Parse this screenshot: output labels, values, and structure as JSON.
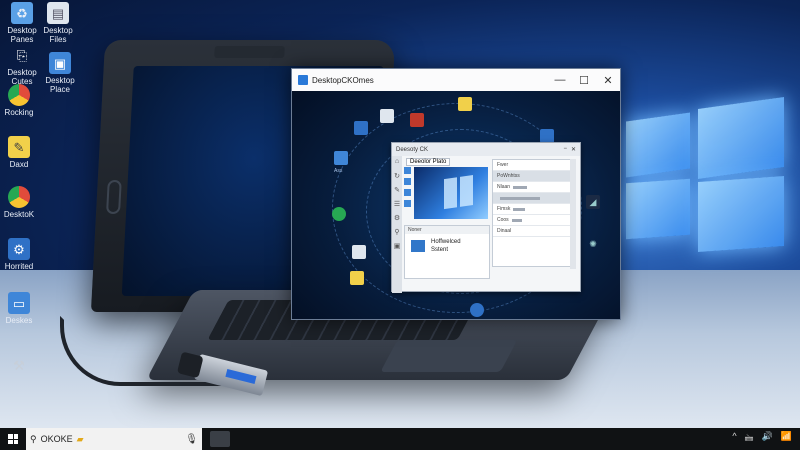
{
  "desktop": {
    "icons": [
      {
        "label": "Desktop\nPanes",
        "icon": "recycle-bin-icon",
        "color": "#5aa0e6"
      },
      {
        "label": "Desktop\nFiles",
        "icon": "file-icon",
        "color": "#dfe6ee"
      },
      {
        "label": "Desktop\nCutes",
        "icon": "shortcut-icon",
        "color": "#2f71c6"
      },
      {
        "label": "Desktop\nPlace",
        "icon": "folder-icon",
        "color": "#3f86d8"
      },
      {
        "label": "Rocking",
        "icon": "chrome-icon",
        "color": "#e14b3b"
      },
      {
        "label": "Daxd",
        "icon": "notes-icon",
        "color": "#f1d04a"
      },
      {
        "label": "DesktoK",
        "icon": "chrome-icon",
        "color": "#e14b3b"
      },
      {
        "label": "Horrited",
        "icon": "gear-icon",
        "color": "#2f71c6"
      },
      {
        "label": "Deskes",
        "icon": "monitor-icon",
        "color": "#3f86d8"
      },
      {
        "label": "",
        "icon": "tool-icon",
        "color": "#c7cfd9"
      }
    ]
  },
  "window": {
    "title": "DesktopCKOmes",
    "minimize": "—",
    "maximize": "☐",
    "close": "✕",
    "orbit_label": "Ass"
  },
  "dialog": {
    "title": "Deesoty CK",
    "tab": "Deeolor Plato",
    "right_header": "Fwer",
    "right_rows": [
      "PoWnhtss",
      "Nlaan",
      "",
      "Fimsk",
      "Coos",
      "Dinaal"
    ],
    "lower_label": "Noner",
    "lower_line1": "Hoffwelced",
    "lower_line2": "Sstent"
  },
  "taskbar": {
    "search_text": "OKOKE",
    "mic": "🎙",
    "tray_icons": [
      "^",
      "🖮",
      "🔊",
      "📶"
    ]
  },
  "colors": {
    "accent": "#2a79d8",
    "taskbar": "#101214"
  }
}
